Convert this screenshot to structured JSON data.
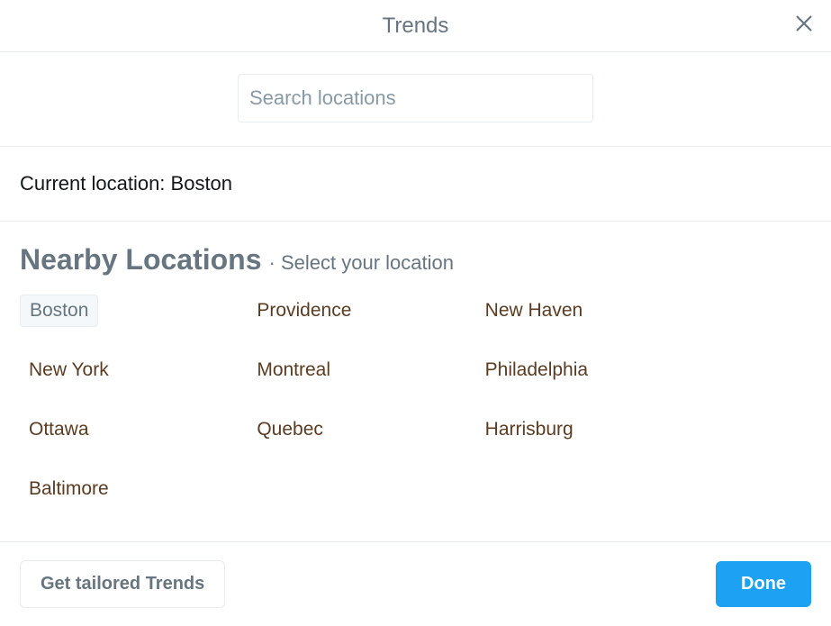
{
  "header": {
    "title": "Trends"
  },
  "search": {
    "placeholder": "Search locations",
    "value": ""
  },
  "current_location": {
    "label_prefix": "Current location: ",
    "value": "Boston"
  },
  "nearby": {
    "title": "Nearby Locations",
    "separator": " · ",
    "subtitle": "Select your location",
    "locations": [
      {
        "name": "Boston",
        "selected": true
      },
      {
        "name": "Providence",
        "selected": false
      },
      {
        "name": "New Haven",
        "selected": false
      },
      {
        "name": "New York",
        "selected": false
      },
      {
        "name": "Montreal",
        "selected": false
      },
      {
        "name": "Philadelphia",
        "selected": false
      },
      {
        "name": "Ottawa",
        "selected": false
      },
      {
        "name": "Quebec",
        "selected": false
      },
      {
        "name": "Harrisburg",
        "selected": false
      },
      {
        "name": "Baltimore",
        "selected": false
      }
    ]
  },
  "footer": {
    "tailored_label": "Get tailored Trends",
    "done_label": "Done"
  }
}
